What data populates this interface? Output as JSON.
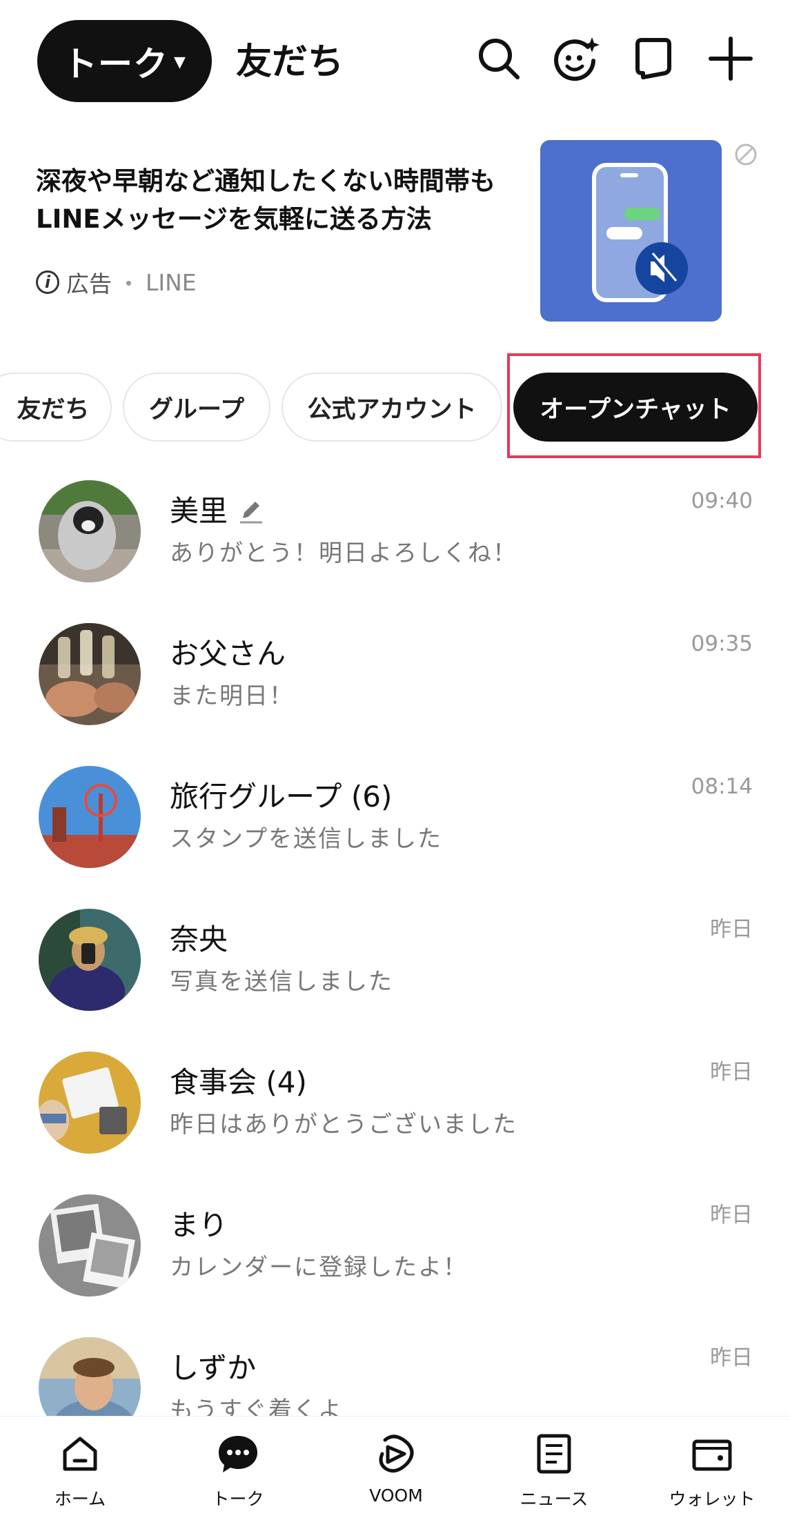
{
  "header": {
    "active_tab": "トーク",
    "other_tab": "友だち",
    "icons": [
      "search-icon",
      "face-sticker-icon",
      "chat-bubble-icon",
      "plus-icon"
    ]
  },
  "ad": {
    "text": "深夜や早朝など通知したくない時間帯もLINEメッセージを気軽に送る方法",
    "label": "広告",
    "separator": "・",
    "source": "LINE",
    "thumb_color": "#4d6fcd"
  },
  "chips": [
    {
      "label": "友だち",
      "active": false
    },
    {
      "label": "グループ",
      "active": false
    },
    {
      "label": "公式アカウント",
      "active": false
    },
    {
      "label": "オープンチャット",
      "active": true
    }
  ],
  "chats": [
    {
      "name": "美里",
      "message": "ありがとう！明日よろしくね！",
      "time": "09:40",
      "pencil": true
    },
    {
      "name": "お父さん",
      "message": "また明日！",
      "time": "09:35"
    },
    {
      "name": "旅行グループ (6)",
      "message": "スタンプを送信しました",
      "time": "08:14"
    },
    {
      "name": "奈央",
      "message": "写真を送信しました",
      "time": "昨日"
    },
    {
      "name": "食事会 (4)",
      "message": "昨日はありがとうございました",
      "time": "昨日"
    },
    {
      "name": "まり",
      "message": "カレンダーに登録したよ！",
      "time": "昨日"
    },
    {
      "name": "しずか",
      "message": "もうすぐ着くよ",
      "time": "昨日"
    }
  ],
  "nav": [
    {
      "label": "ホーム",
      "icon": "home-icon"
    },
    {
      "label": "トーク",
      "icon": "talk-icon"
    },
    {
      "label": "VOOM",
      "icon": "voom-icon"
    },
    {
      "label": "ニュース",
      "icon": "news-icon"
    },
    {
      "label": "ウォレット",
      "icon": "wallet-icon"
    }
  ],
  "colors": {
    "accent": "#111111",
    "highlight": "#e8385a",
    "muted": "#999999"
  }
}
